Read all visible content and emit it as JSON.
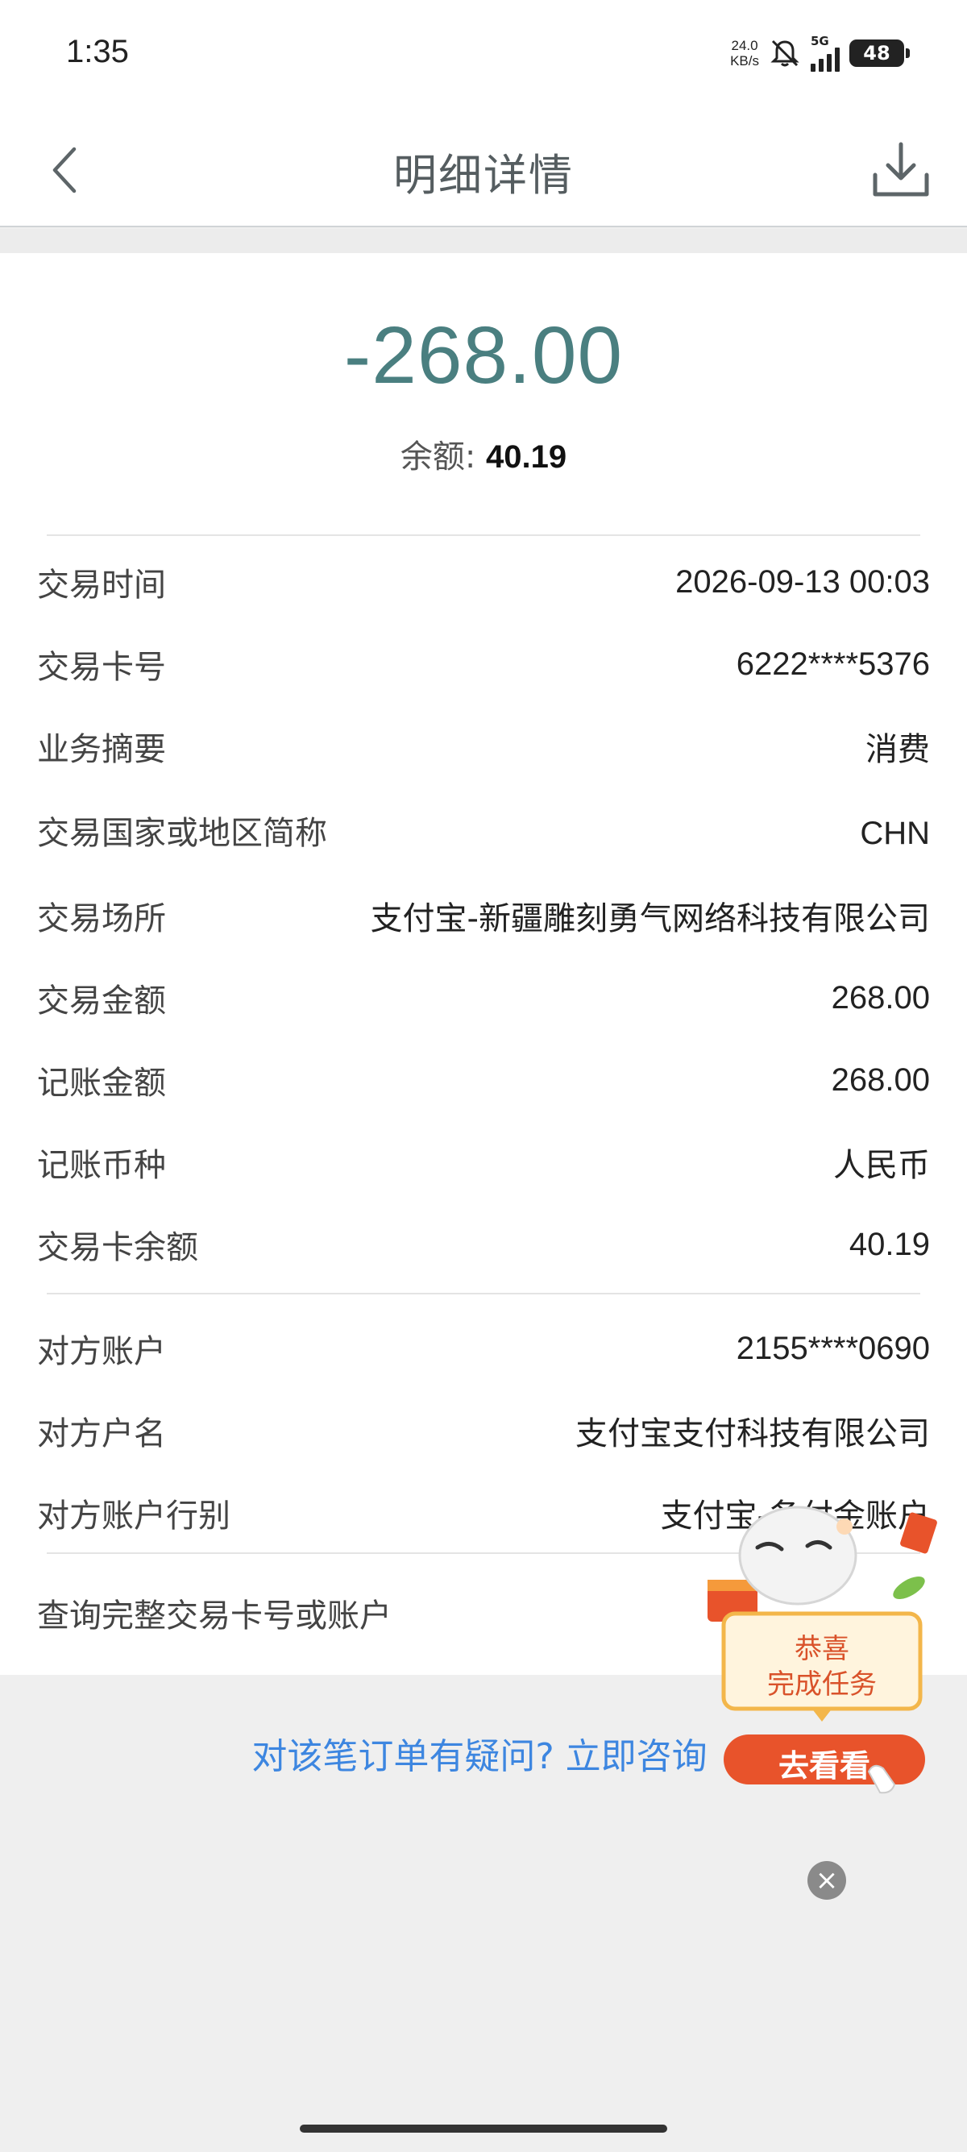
{
  "status_bar": {
    "time": "1:35",
    "net_speed_value": "24.0",
    "net_speed_unit": "KB/s",
    "network": "5G",
    "battery": "48"
  },
  "nav": {
    "title": "明细详情",
    "back_icon": "chevron-left-icon",
    "download_icon": "download-icon"
  },
  "summary": {
    "amount": "-268.00",
    "balance_label": "余额:",
    "balance_value": "40.19"
  },
  "details": [
    {
      "label": "交易时间",
      "value": "2026-09-13 00:03"
    },
    {
      "label": "交易卡号",
      "value": "6222****5376"
    },
    {
      "label": "业务摘要",
      "value": "消费"
    },
    {
      "label": "交易国家或地区简称",
      "value": "CHN"
    },
    {
      "label": "交易场所",
      "value": "支付宝-新疆雕刻勇气网络科技有限公司"
    },
    {
      "label": "交易金额",
      "value": "268.00"
    },
    {
      "label": "记账金额",
      "value": "268.00"
    },
    {
      "label": "记账币种",
      "value": "人民币"
    },
    {
      "label": "交易卡余额",
      "value": "40.19"
    }
  ],
  "counterparty": [
    {
      "label": "对方账户",
      "value": "2155****0690"
    },
    {
      "label": "对方户名",
      "value": "支付宝支付科技有限公司"
    },
    {
      "label": "对方账户行别",
      "value": "支付宝-备付金账户"
    }
  ],
  "query_link": "查询完整交易卡号或账户",
  "consult_link": "对该笔订单有疑问? 立即咨询",
  "promo": {
    "line1": "恭喜",
    "line2": "完成任务",
    "button": "去看看",
    "close": "×"
  },
  "colors": {
    "amount": "#4a7f80",
    "link": "#3d86e0",
    "promo_red": "#e8532b"
  }
}
